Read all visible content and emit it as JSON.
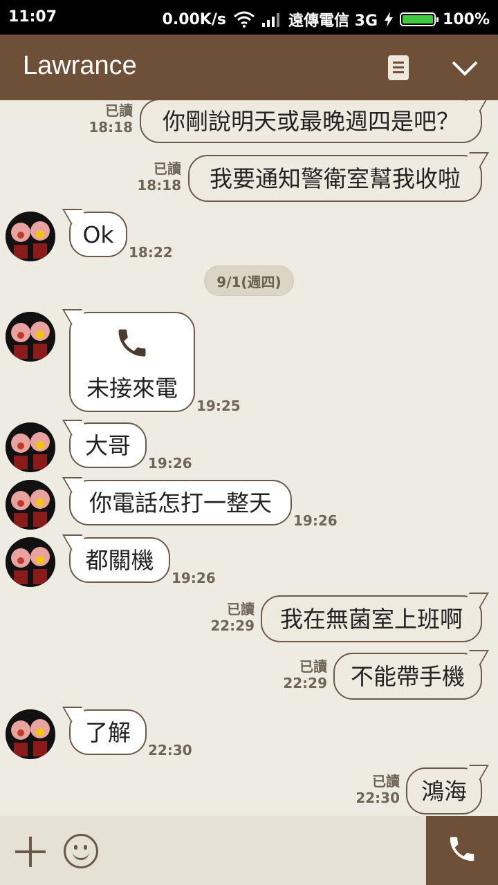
{
  "status": {
    "time": "11:07",
    "speed": "0.00K/s",
    "carrier": "遠傳電信 3G",
    "battery": "100%"
  },
  "header": {
    "title": "Lawrance"
  },
  "date_divider": "9/1(週四)",
  "messages": [
    {
      "dir": "out",
      "text": "你剛說明天或最晚週四是吧？",
      "read": "已讀",
      "time": "18:18"
    },
    {
      "dir": "out",
      "text": "我要通知警衛室幫我收啦",
      "read": "已讀",
      "time": "18:18"
    },
    {
      "dir": "in",
      "text": "Ok",
      "time": "18:22"
    },
    {
      "dir": "in",
      "text": "未接來電",
      "time": "19:25"
    },
    {
      "dir": "in",
      "text": "大哥",
      "time": "19:26"
    },
    {
      "dir": "in",
      "text": "你電話怎打一整天",
      "time": "19:26"
    },
    {
      "dir": "in",
      "text": "都關機",
      "time": "19:26"
    },
    {
      "dir": "out",
      "text": "我在無菌室上班啊",
      "read": "已讀",
      "time": "22:29"
    },
    {
      "dir": "out",
      "text": "不能帶手機",
      "read": "已讀",
      "time": "22:29"
    },
    {
      "dir": "in",
      "text": "了解",
      "time": "22:30"
    },
    {
      "dir": "out",
      "text": "鴻海",
      "read": "已讀",
      "time": "22:30"
    }
  ],
  "colors": {
    "header": "#6e4f37",
    "background": "#eeebe2",
    "bubble_border": "#6b5a48"
  },
  "icons": {
    "note": "note-icon",
    "collapse": "chevron-down-icon",
    "add": "plus-icon",
    "emoji": "emoji-icon",
    "call": "phone-icon"
  }
}
